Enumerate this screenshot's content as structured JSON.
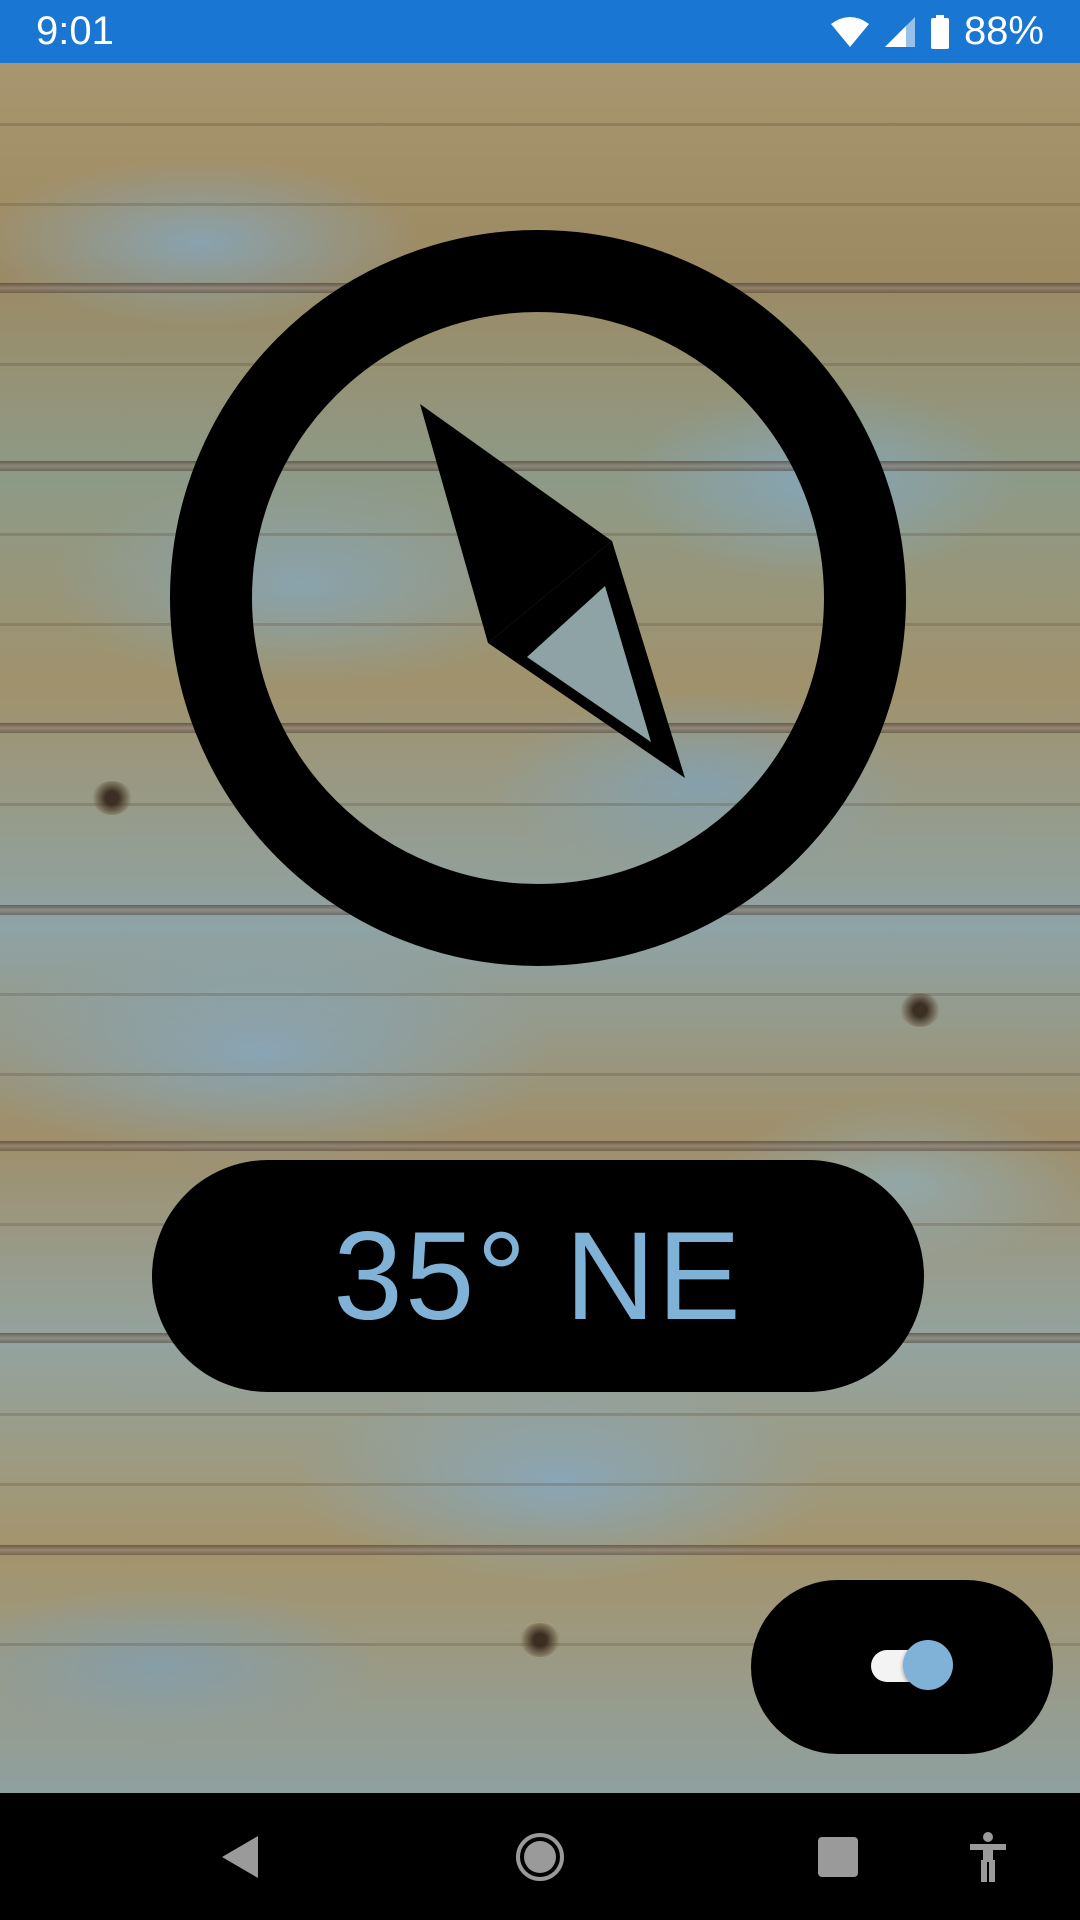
{
  "status_bar": {
    "time": "9:01",
    "battery_percent": "88%",
    "icons": [
      "wifi-icon",
      "signal-icon",
      "battery-icon"
    ],
    "background_color": "#1976d2"
  },
  "compass": {
    "icon": "compass-icon",
    "bearing_degrees": 35
  },
  "heading": {
    "text": "35° NE",
    "text_color": "#7fb2d6"
  },
  "toggle": {
    "state": "on",
    "accent_color": "#7fb2d6"
  },
  "nav_bar": {
    "buttons": [
      "back-icon",
      "home-icon",
      "recents-icon",
      "accessibility-icon"
    ]
  }
}
